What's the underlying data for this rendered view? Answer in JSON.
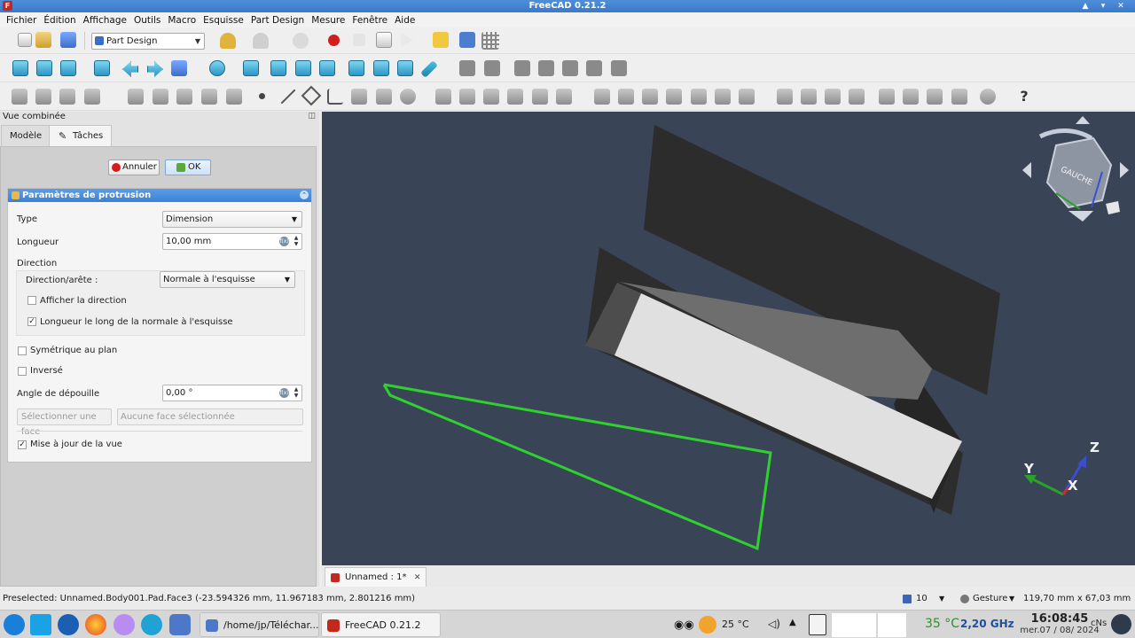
{
  "window": {
    "title": "FreeCAD 0.21.2"
  },
  "menu": [
    "Fichier",
    "Édition",
    "Affichage",
    "Outils",
    "Macro",
    "Esquisse",
    "Part Design",
    "Mesure",
    "Fenêtre",
    "Aide"
  ],
  "toolbar": {
    "workbench": "Part Design"
  },
  "panel": {
    "title": "Vue combinée",
    "tabs": [
      "Modèle",
      "Tâches"
    ],
    "cancel_label": "Annuler",
    "ok_label": "OK",
    "params": {
      "title": "Paramètres de protrusion",
      "type_label": "Type",
      "type_value": "Dimension",
      "length_label": "Longueur",
      "length_value": "10,00 mm",
      "direction_label": "Direction",
      "direction_edge_label": "Direction/arête :",
      "direction_edge_value": "Normale à l'esquisse",
      "show_direction_label": "Afficher la direction",
      "show_direction_checked": false,
      "length_along_normal_label": "Longueur le long de la normale à l'esquisse",
      "length_along_normal_checked": true,
      "symmetric_label": "Symétrique au plan",
      "symmetric_checked": false,
      "reversed_label": "Inversé",
      "reversed_checked": false,
      "taper_label": "Angle de dépouille",
      "taper_value": "0,00 °",
      "select_face_label": "Sélectionner une face",
      "selected_face_value": "Aucune face sélectionnée",
      "update_view_label": "Mise à jour de la vue",
      "update_view_checked": true
    }
  },
  "viewport": {
    "navcube_face": "GAUCHE",
    "axes": {
      "x": "X",
      "y": "Y",
      "z": "Z"
    },
    "colors": {
      "background": "#394456",
      "sketch": "#2fd12f",
      "axis_x": "#d22b2b",
      "axis_y": "#2ca02c",
      "axis_z": "#3a4fd0"
    }
  },
  "document_tab": {
    "label": "Unnamed : 1*"
  },
  "statusbar": {
    "message": "Preselected: Unnamed.Body001.Pad.Face3 (-23.594326 mm, 11.967183 mm, 2.801216 mm)",
    "zoom_steps": "10",
    "nav_style": "Gesture",
    "dimensions": "119,70 mm x 67,03 mm"
  },
  "taskbar": {
    "tasks": [
      "/home/jp/Téléchar...",
      "FreeCAD 0.21.2"
    ],
    "weather": "25 °C",
    "cpu_temp": "35 °C",
    "cpu_freq": "2,20 GHz",
    "time": "16:08:45",
    "date": "mer.07 / 08/ 2024"
  }
}
